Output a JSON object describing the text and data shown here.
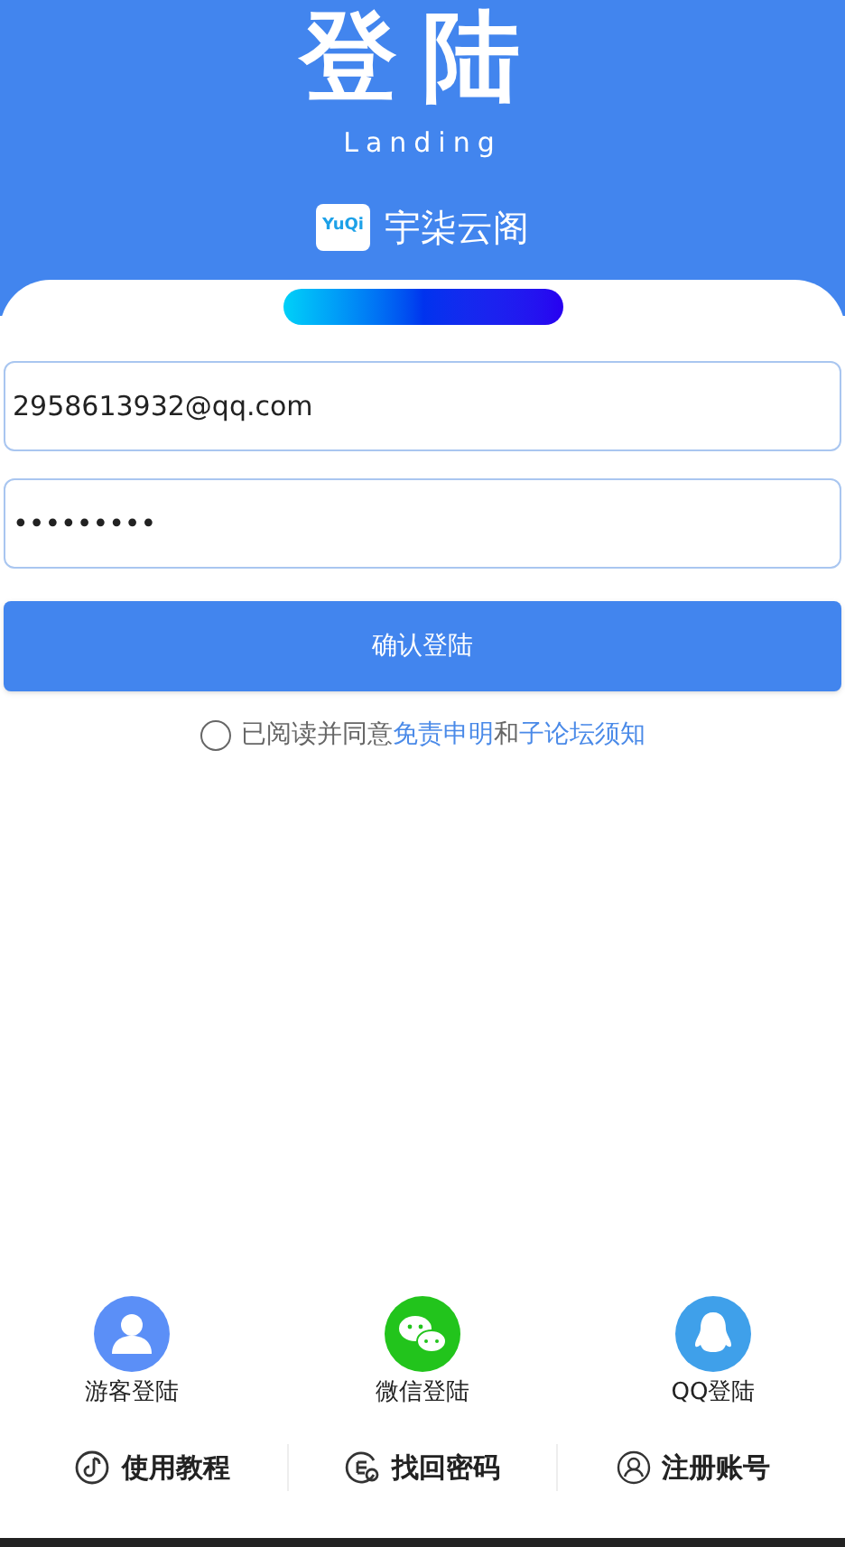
{
  "header": {
    "title": "登陆",
    "subtitle": "Landing",
    "brand": {
      "logo": "YuQi",
      "name": "宇柒云阁"
    }
  },
  "form": {
    "email": {
      "value": "2958613932@qq.com"
    },
    "password": {
      "value": "•••••••••"
    },
    "submit": "确认登陆"
  },
  "agreement": {
    "checked": false,
    "parts": [
      {
        "kind": "text",
        "text": "已阅读并同意"
      },
      {
        "kind": "link",
        "text": "免责申明"
      },
      {
        "kind": "text",
        "text": "和"
      },
      {
        "kind": "link",
        "text": "子论坛须知"
      }
    ]
  },
  "social_logins": [
    {
      "kind": "guest",
      "label": "游客登陆",
      "color": "#5b8ff7"
    },
    {
      "kind": "wechat",
      "label": "微信登陆",
      "color": "#22c41c"
    },
    {
      "kind": "qq",
      "label": "QQ登陆",
      "color": "#3fa0ea"
    }
  ],
  "footer_links": [
    {
      "kind": "tutorial",
      "label": "使用教程"
    },
    {
      "kind": "recover",
      "label": "找回密码"
    },
    {
      "kind": "register",
      "label": "注册账号"
    }
  ]
}
